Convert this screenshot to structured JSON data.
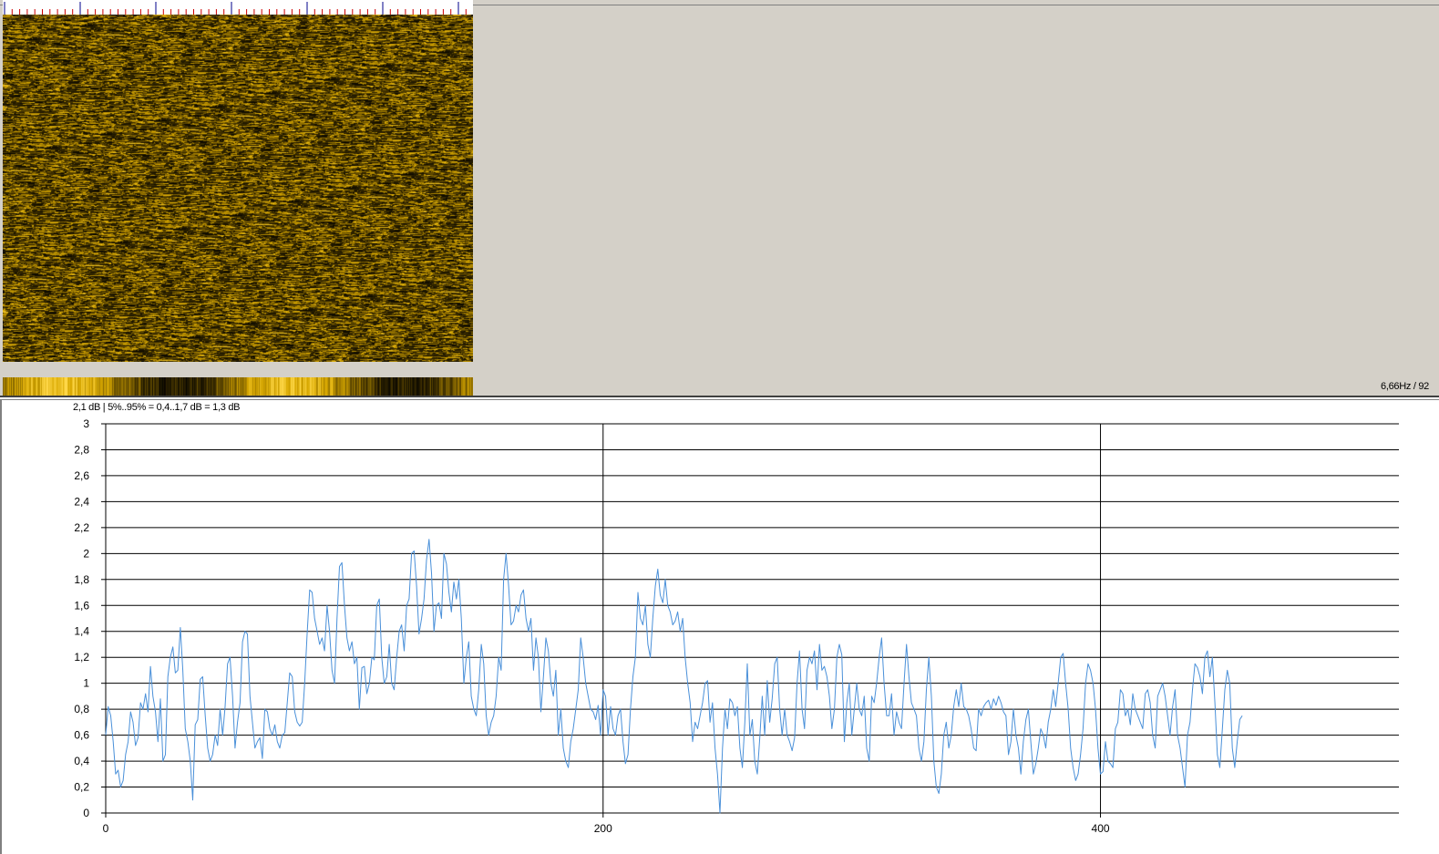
{
  "spectrogram": {
    "colormap": [
      "#000000",
      "#3a2c00",
      "#8a6a00",
      "#d8a800",
      "#ffd84a"
    ],
    "status_text": "6,66Hz / 92"
  },
  "stats": {
    "text": "2,1 dB | 5%..95% = 0,4..1,7 dB = 1,3 dB"
  },
  "chart_data": {
    "type": "line",
    "title": "",
    "xlabel": "",
    "ylabel": "",
    "xlim": [
      0,
      520
    ],
    "ylim": [
      0,
      3
    ],
    "x_ticks": [
      0,
      200,
      400
    ],
    "y_ticks": [
      0,
      0.2,
      0.4,
      0.6,
      0.8,
      1,
      1.2,
      1.4,
      1.6,
      1.8,
      2,
      2.2,
      2.4,
      2.6,
      2.8,
      3
    ],
    "grid": true,
    "line_color": "#4a90d9",
    "series": [
      {
        "values": [
          0.6,
          0.82,
          0.75,
          0.55,
          0.3,
          0.33,
          0.2,
          0.25,
          0.45,
          0.55,
          0.78,
          0.7,
          0.52,
          0.58,
          0.85,
          0.8,
          0.92,
          0.78,
          1.13,
          0.9,
          0.78,
          0.55,
          0.88,
          0.4,
          0.45,
          1.05,
          1.2,
          1.28,
          1.08,
          1.1,
          1.43,
          1.1,
          0.65,
          0.55,
          0.4,
          0.1,
          0.68,
          0.72,
          1.03,
          1.05,
          0.75,
          0.5,
          0.4,
          0.45,
          0.6,
          0.52,
          0.8,
          0.6,
          0.82,
          1.15,
          1.2,
          0.9,
          0.5,
          0.7,
          0.85,
          1.32,
          1.4,
          1.38,
          0.9,
          0.7,
          0.5,
          0.55,
          0.58,
          0.42,
          0.8,
          0.78,
          0.65,
          0.6,
          0.68,
          0.55,
          0.5,
          0.6,
          0.62,
          0.85,
          1.08,
          1.05,
          0.78,
          0.7,
          0.67,
          0.7,
          1.0,
          1.38,
          1.72,
          1.7,
          1.5,
          1.4,
          1.3,
          1.35,
          1.25,
          1.6,
          1.4,
          1.1,
          1.0,
          1.5,
          1.9,
          1.93,
          1.6,
          1.35,
          1.25,
          1.32,
          1.15,
          1.2,
          0.8,
          1.12,
          1.13,
          0.92,
          1.0,
          1.2,
          1.18,
          1.6,
          1.65,
          1.2,
          1.0,
          1.05,
          1.3,
          1.0,
          0.95,
          1.2,
          1.4,
          1.45,
          1.25,
          1.6,
          1.65,
          2.0,
          2.02,
          1.75,
          1.38,
          1.5,
          1.65,
          1.95,
          2.11,
          1.85,
          1.4,
          1.6,
          1.62,
          1.5,
          2.0,
          1.92,
          1.7,
          1.55,
          1.78,
          1.65,
          1.8,
          1.5,
          1.0,
          1.2,
          1.32,
          0.9,
          0.8,
          0.75,
          0.95,
          1.3,
          1.15,
          0.75,
          0.6,
          0.7,
          0.75,
          0.9,
          1.2,
          1.1,
          1.8,
          2.0,
          1.75,
          1.45,
          1.48,
          1.6,
          1.55,
          1.68,
          1.72,
          1.5,
          1.4,
          1.5,
          1.1,
          1.35,
          1.2,
          0.78,
          1.05,
          1.35,
          1.25,
          1.0,
          0.9,
          1.1,
          0.6,
          0.8,
          0.5,
          0.4,
          0.35,
          0.55,
          0.65,
          0.8,
          0.95,
          1.35,
          1.2,
          1.0,
          0.9,
          0.8,
          0.78,
          0.72,
          0.83,
          0.6,
          0.95,
          0.9,
          0.6,
          0.82,
          0.65,
          0.6,
          0.75,
          0.8,
          0.55,
          0.38,
          0.45,
          0.8,
          1.05,
          1.2,
          1.7,
          1.5,
          1.45,
          1.6,
          1.3,
          1.2,
          1.5,
          1.75,
          1.88,
          1.68,
          1.62,
          1.8,
          1.6,
          1.55,
          1.45,
          1.48,
          1.55,
          1.4,
          1.5,
          1.2,
          1.0,
          0.85,
          0.55,
          0.7,
          0.65,
          0.75,
          0.85,
          1.0,
          1.02,
          0.7,
          0.85,
          0.5,
          0.3,
          0.0,
          0.5,
          0.8,
          0.65,
          0.88,
          0.85,
          0.75,
          0.82,
          0.5,
          0.35,
          0.7,
          1.15,
          0.6,
          0.72,
          0.4,
          0.3,
          0.58,
          0.9,
          0.6,
          1.02,
          0.7,
          0.88,
          1.15,
          1.2,
          0.8,
          0.6,
          0.8,
          0.6,
          0.55,
          0.48,
          0.58,
          1.0,
          1.25,
          0.8,
          0.65,
          1.1,
          1.2,
          1.15,
          1.25,
          0.95,
          1.3,
          1.1,
          1.13,
          1.05,
          0.9,
          0.65,
          0.8,
          1.2,
          1.3,
          1.22,
          0.55,
          0.85,
          1.0,
          0.6,
          0.8,
          1.0,
          0.8,
          0.75,
          0.9,
          0.5,
          0.4,
          0.9,
          0.85,
          1.0,
          1.2,
          1.35,
          1.0,
          0.75,
          0.75,
          0.92,
          0.6,
          0.78,
          0.7,
          0.65,
          1.0,
          1.3,
          1.05,
          0.85,
          0.8,
          0.75,
          0.5,
          0.4,
          0.55,
          0.95,
          1.2,
          0.9,
          0.4,
          0.2,
          0.15,
          0.3,
          0.6,
          0.7,
          0.5,
          0.6,
          0.82,
          0.95,
          0.82,
          1.0,
          0.82,
          0.8,
          0.75,
          0.65,
          0.5,
          0.48,
          0.8,
          0.75,
          0.82,
          0.85,
          0.87,
          0.8,
          0.88,
          0.83,
          0.9,
          0.85,
          0.78,
          0.75,
          0.45,
          0.55,
          0.8,
          0.6,
          0.5,
          0.3,
          0.55,
          0.72,
          0.8,
          0.55,
          0.3,
          0.38,
          0.5,
          0.65,
          0.6,
          0.5,
          0.7,
          0.8,
          0.95,
          0.82,
          1.0,
          1.2,
          1.23,
          1.0,
          0.8,
          0.5,
          0.35,
          0.25,
          0.3,
          0.45,
          0.65,
          1.0,
          1.15,
          1.1,
          1.0,
          0.8,
          0.5,
          0.3,
          0.32,
          0.55,
          0.4,
          0.38,
          0.35,
          0.65,
          0.7,
          0.95,
          0.92,
          0.75,
          0.8,
          0.68,
          0.92,
          0.8,
          0.75,
          0.7,
          0.65,
          0.92,
          0.95,
          0.85,
          0.6,
          0.5,
          0.9,
          0.95,
          1.0,
          0.9,
          0.75,
          0.6,
          0.82,
          0.95,
          0.6,
          0.5,
          0.35,
          0.2,
          0.6,
          0.7,
          0.95,
          1.15,
          1.12,
          1.05,
          0.92,
          1.2,
          1.25,
          1.05,
          1.2,
          0.85,
          0.45,
          0.35,
          0.65,
          0.95,
          1.1,
          1.0,
          0.5,
          0.35,
          0.55,
          0.72,
          0.75
        ]
      }
    ]
  }
}
